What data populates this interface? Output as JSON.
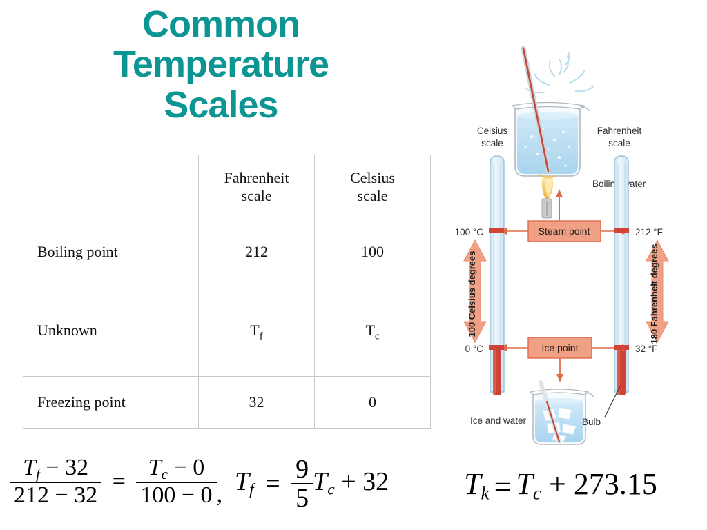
{
  "title": {
    "line1": "Common",
    "line2": "Temperature",
    "line3": "Scales",
    "color": "#0d9594"
  },
  "table": {
    "headers": {
      "corner": "",
      "fahrenheit_line1": "Fahrenheit",
      "fahrenheit_line2": "scale",
      "celsius_line1": "Celsius",
      "celsius_line2": "scale"
    },
    "rows": [
      {
        "label": "Boiling point",
        "fahrenheit": "212",
        "celsius": "100"
      },
      {
        "label": "Unknown",
        "fahrenheit_base": "T",
        "fahrenheit_sub": "f",
        "celsius_base": "T",
        "celsius_sub": "c"
      },
      {
        "label": "Freezing point",
        "fahrenheit": "32",
        "celsius": "0"
      }
    ]
  },
  "equations": {
    "eq1": {
      "num1_base": "T",
      "num1_sub": "f",
      "num1_rest": " − 32",
      "den1": "212 − 32",
      "equals": "=",
      "num2_base": "T",
      "num2_sub": "c",
      "num2_rest": " − 0",
      "den2": "100 − 0",
      "trailing": ","
    },
    "eq2": {
      "lhs_base": "T",
      "lhs_sub": "f",
      "equals": "=",
      "num": "9",
      "den": "5",
      "rhs_base": "T",
      "rhs_sub": "c",
      "tail": " + 32"
    },
    "eq3": {
      "lhs_base": "T",
      "lhs_sub": "k",
      "equals": "=",
      "rhs_base": "T",
      "rhs_sub": "c",
      "tail": " + 273.15"
    }
  },
  "diagram": {
    "labels": {
      "boiling_water": "Boiling water",
      "celsius_scale_l1": "Celsius",
      "celsius_scale_l2": "scale",
      "fahrenheit_scale_l1": "Fahrenheit",
      "fahrenheit_scale_l2": "scale",
      "steam_point": "Steam point",
      "ice_point": "Ice point",
      "celsius_steam": "100 °C",
      "fahrenheit_steam": "212 °F",
      "celsius_ice": "0 °C",
      "fahrenheit_ice": "32 °F",
      "celsius_span": "100 Celsius degrees",
      "fahrenheit_span": "180 Fahrenheit degrees",
      "ice_and_water": "Ice and water",
      "bulb": "Bulb"
    },
    "colors": {
      "callout_fill": "#f0a085",
      "callout_stroke": "#e06b4a",
      "arrow_fill": "#f0a085",
      "tube_fill": "#dceaf5",
      "tube_stroke": "#9dc3db",
      "mercury": "#cf4436",
      "water": "#b9dcf0",
      "flame": "#f6c35a"
    }
  }
}
